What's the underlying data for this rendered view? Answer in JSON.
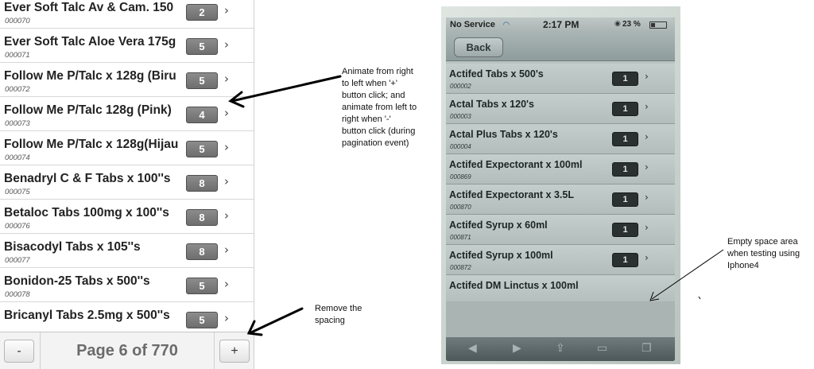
{
  "list": {
    "items": [
      {
        "name": "Ever Soft Talc Av & Cam. 150",
        "code": "000070",
        "count": "2"
      },
      {
        "name": "Ever Soft Talc Aloe Vera 175g",
        "code": "000071",
        "count": "5"
      },
      {
        "name": "Follow Me P/Talc x 128g (Biru",
        "code": "000072",
        "count": "5"
      },
      {
        "name": "Follow Me P/Talc 128g (Pink)",
        "code": "000073",
        "count": "4"
      },
      {
        "name": "Follow Me P/Talc x 128g(Hijau",
        "code": "000074",
        "count": "5"
      },
      {
        "name": "Benadryl C & F Tabs x 100''s",
        "code": "000075",
        "count": "8"
      },
      {
        "name": "Betaloc Tabs 100mg x 100''s",
        "code": "000076",
        "count": "8"
      },
      {
        "name": "Bisacodyl Tabs x 105''s",
        "code": "000077",
        "count": "8"
      },
      {
        "name": "Bonidon-25 Tabs x 500''s",
        "code": "000078",
        "count": "5"
      },
      {
        "name": "Bricanyl Tabs 2.5mg x 500''s",
        "code": "",
        "count": "5"
      }
    ],
    "chevron": "›"
  },
  "pager": {
    "prev_label": "-",
    "next_label": "+",
    "page_label": "Page 6 of 770"
  },
  "annotations": {
    "animate_note": [
      "Animate from right",
      "to left when '+'",
      "button click; and",
      "animate from left to",
      "right when '-'",
      "button click (during",
      "pagination event)"
    ],
    "remove_spacing_note": [
      "Remove the",
      "spacing"
    ],
    "empty_space_note": [
      "Empty space area",
      "when testing using",
      "Iphone4"
    ]
  },
  "phone": {
    "status": {
      "carrier": "No Service",
      "time": "2:17 PM",
      "battery": "23 %"
    },
    "back_label": "Back",
    "items": [
      {
        "name": "Actifed Tabs x 500's",
        "code": "000002",
        "count": "1"
      },
      {
        "name": "Actal Tabs x 120's",
        "code": "000003",
        "count": "1"
      },
      {
        "name": "Actal Plus Tabs x 120's",
        "code": "000004",
        "count": "1"
      },
      {
        "name": "Actifed Expectorant x 100ml",
        "code": "000869",
        "count": "1"
      },
      {
        "name": "Actifed Expectorant x 3.5L",
        "code": "000870",
        "count": "1"
      },
      {
        "name": "Actifed Syrup x 60ml",
        "code": "000871",
        "count": "1"
      },
      {
        "name": "Actifed Syrup x 100ml",
        "code": "000872",
        "count": "1"
      },
      {
        "name": "Actifed DM Linctus x 100ml",
        "code": "",
        "count": ""
      }
    ],
    "icons": [
      "back-arrow-icon",
      "forward-arrow-icon",
      "share-icon",
      "bookmarks-icon",
      "tabs-icon"
    ]
  },
  "colors": {
    "badge_gray": "#7a7a7a",
    "phone_badge": "#2b3131",
    "pager_text": "#6b6b6b"
  }
}
